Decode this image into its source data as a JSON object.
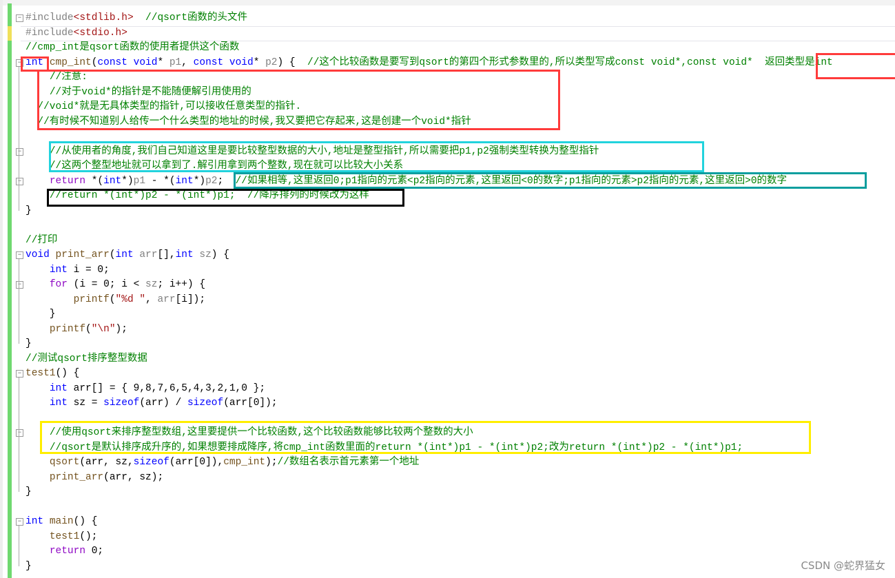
{
  "editor": {
    "lines": [
      [
        [
          "p",
          "#include"
        ],
        [
          "h",
          "<stdlib.h>"
        ],
        [
          "t",
          "  "
        ],
        [
          "c",
          "//qsort函数的头文件"
        ]
      ],
      [
        [
          "p",
          "#include"
        ],
        [
          "h",
          "<stdio.h>"
        ]
      ],
      [
        [
          "c",
          "//cmp_int是qsort函数的使用者提供这个函数"
        ]
      ],
      [
        [
          "k",
          "int"
        ],
        [
          "t",
          " "
        ],
        [
          "f",
          "cmp_int"
        ],
        [
          "t",
          "("
        ],
        [
          "k",
          "const void"
        ],
        [
          "t",
          "* "
        ],
        [
          "v",
          "p1"
        ],
        [
          "t",
          ", "
        ],
        [
          "k",
          "const void"
        ],
        [
          "t",
          "* "
        ],
        [
          "v",
          "p2"
        ],
        [
          "t",
          ") {  "
        ],
        [
          "c",
          "//这个比较函数是要写到qsort的第四个形式参数里的,所以类型写成const void*,const void*  返回类型是int"
        ]
      ],
      [
        [
          "t",
          "    "
        ],
        [
          "c",
          "//注意:"
        ]
      ],
      [
        [
          "t",
          "    "
        ],
        [
          "c",
          "//对于void*的指针是不能随便解引用使用的"
        ]
      ],
      [
        [
          "t",
          "  "
        ],
        [
          "c",
          "//void*就是无具体类型的指针,可以接收任意类型的指针."
        ]
      ],
      [
        [
          "t",
          "  "
        ],
        [
          "c",
          "//有时候不知道别人给传一个什么类型的地址的时候,我又要把它存起来,这是创建一个void*指针"
        ]
      ],
      [],
      [
        [
          "t",
          "    "
        ],
        [
          "c",
          "//从使用者的角度,我们自己知道这里是要比较整型数据的大小,地址是整型指针,所以需要把p1,p2强制类型转换为整型指针"
        ]
      ],
      [
        [
          "t",
          "    "
        ],
        [
          "c",
          "//这两个整型地址就可以拿到了.解引用拿到两个整数,现在就可以比较大小关系"
        ]
      ],
      [
        [
          "t",
          "    "
        ],
        [
          "r",
          "return"
        ],
        [
          "t",
          " *("
        ],
        [
          "k",
          "int"
        ],
        [
          "t",
          "*)"
        ],
        [
          "v",
          "p1"
        ],
        [
          "t",
          " - *("
        ],
        [
          "k",
          "int"
        ],
        [
          "t",
          "*)"
        ],
        [
          "v",
          "p2"
        ],
        [
          "t",
          ";  "
        ],
        [
          "c",
          "//如果相等,这里返回0;p1指向的元素<p2指向的元素,这里返回<0的数字;p1指向的元素>p2指向的元素,这里返回>0的数字"
        ]
      ],
      [
        [
          "t",
          "    "
        ],
        [
          "c",
          "//return *(int*)p2 - *(int*)p1;  //降序排列的时候改为这样"
        ]
      ],
      [
        [
          "t",
          "}"
        ]
      ],
      [],
      [
        [
          "c",
          "//打印"
        ]
      ],
      [
        [
          "k",
          "void"
        ],
        [
          "t",
          " "
        ],
        [
          "f",
          "print_arr"
        ],
        [
          "t",
          "("
        ],
        [
          "k",
          "int"
        ],
        [
          "t",
          " "
        ],
        [
          "v",
          "arr"
        ],
        [
          "t",
          "[],"
        ],
        [
          "k",
          "int"
        ],
        [
          "t",
          " "
        ],
        [
          "v",
          "sz"
        ],
        [
          "t",
          ") {"
        ]
      ],
      [
        [
          "t",
          "    "
        ],
        [
          "k",
          "int"
        ],
        [
          "t",
          " i = 0;"
        ]
      ],
      [
        [
          "t",
          "    "
        ],
        [
          "r",
          "for"
        ],
        [
          "t",
          " (i = 0; i < "
        ],
        [
          "v",
          "sz"
        ],
        [
          "t",
          "; i++) {"
        ]
      ],
      [
        [
          "t",
          "        "
        ],
        [
          "f",
          "printf"
        ],
        [
          "t",
          "("
        ],
        [
          "s",
          "\"%d \""
        ],
        [
          "t",
          ", "
        ],
        [
          "v",
          "arr"
        ],
        [
          "t",
          "[i]);"
        ]
      ],
      [
        [
          "t",
          "    }"
        ]
      ],
      [
        [
          "t",
          "    "
        ],
        [
          "f",
          "printf"
        ],
        [
          "t",
          "("
        ],
        [
          "s",
          "\"\\n\""
        ],
        [
          "t",
          ");"
        ]
      ],
      [
        [
          "t",
          "}"
        ]
      ],
      [
        [
          "c",
          "//测试qsort排序整型数据"
        ]
      ],
      [
        [
          "f",
          "test1"
        ],
        [
          "t",
          "() {"
        ]
      ],
      [
        [
          "t",
          "    "
        ],
        [
          "k",
          "int"
        ],
        [
          "t",
          " arr[] = { 9,8,7,6,5,4,3,2,1,0 };"
        ]
      ],
      [
        [
          "t",
          "    "
        ],
        [
          "k",
          "int"
        ],
        [
          "t",
          " sz = "
        ],
        [
          "k",
          "sizeof"
        ],
        [
          "t",
          "(arr) / "
        ],
        [
          "k",
          "sizeof"
        ],
        [
          "t",
          "(arr[0]);"
        ]
      ],
      [],
      [
        [
          "t",
          "    "
        ],
        [
          "c",
          "//使用qsort来排序整型数组,这里要提供一个比较函数,这个比较函数能够比较两个整数的大小"
        ]
      ],
      [
        [
          "t",
          "    "
        ],
        [
          "c",
          "//qsort是默认排序成升序的,如果想要排成降序,将cmp_int函数里面的return *(int*)p1 - *(int*)p2;改为return *(int*)p2 - *(int*)p1;"
        ]
      ],
      [
        [
          "t",
          "    "
        ],
        [
          "f",
          "qsort"
        ],
        [
          "t",
          "(arr, sz,"
        ],
        [
          "k",
          "sizeof"
        ],
        [
          "t",
          "(arr[0]),"
        ],
        [
          "f",
          "cmp_int"
        ],
        [
          "t",
          ");"
        ],
        [
          "c",
          "//数组名表示首元素第一个地址"
        ]
      ],
      [
        [
          "t",
          "    "
        ],
        [
          "f",
          "print_arr"
        ],
        [
          "t",
          "(arr, sz);"
        ]
      ],
      [
        [
          "t",
          "}"
        ]
      ],
      [],
      [
        [
          "k",
          "int"
        ],
        [
          "t",
          " "
        ],
        [
          "f",
          "main"
        ],
        [
          "t",
          "() {"
        ]
      ],
      [
        [
          "t",
          "    "
        ],
        [
          "f",
          "test1"
        ],
        [
          "t",
          "();"
        ]
      ],
      [
        [
          "t",
          "    "
        ],
        [
          "r",
          "return"
        ],
        [
          "t",
          " 0;"
        ]
      ],
      [
        [
          "t",
          "}"
        ]
      ]
    ],
    "fold_markers": "⊟"
  },
  "annotation_colors": {
    "red": "#ff3b3b",
    "cyan": "#22d3dd",
    "teal": "#0a9e9e",
    "black": "#000000",
    "yellow": "#ffee00"
  },
  "watermark": "CSDN @蛇界猛女"
}
